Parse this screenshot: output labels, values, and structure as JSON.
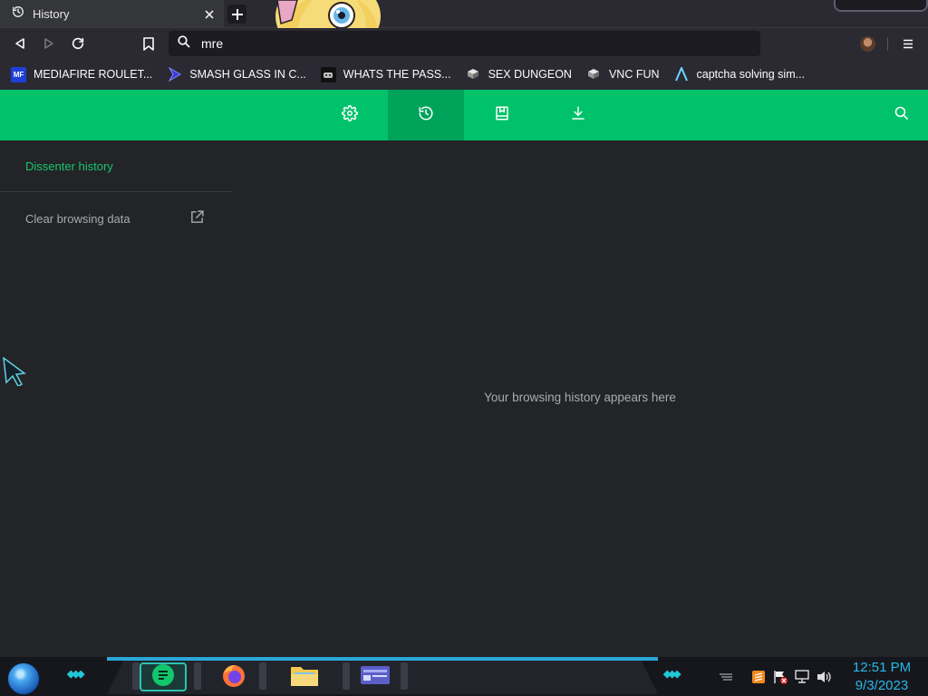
{
  "tab": {
    "title": "History"
  },
  "urlbar": {
    "value": "mre"
  },
  "bookmarks": [
    {
      "label": "MEDIAFIRE ROULET...",
      "icon": "mediafire-icon",
      "badge": "MF"
    },
    {
      "label": "SMASH GLASS IN C...",
      "icon": "chevron-bookmark-icon"
    },
    {
      "label": "WHATS THE PASS...",
      "icon": "robot-icon"
    },
    {
      "label": "SEX DUNGEON",
      "icon": "server-icon"
    },
    {
      "label": "VNC FUN",
      "icon": "server-icon"
    },
    {
      "label": "captcha solving sim...",
      "icon": "caret-a-icon"
    }
  ],
  "sidebar": {
    "title": "Dissenter history",
    "clear_label": "Clear browsing data"
  },
  "main": {
    "empty_message": "Your browsing history appears here"
  },
  "clock": {
    "time": "12:51 PM",
    "date": "9/3/2023"
  },
  "colors": {
    "accent": "#00c26b",
    "accent_dark": "#00a35a",
    "clock": "#29b8e8"
  }
}
